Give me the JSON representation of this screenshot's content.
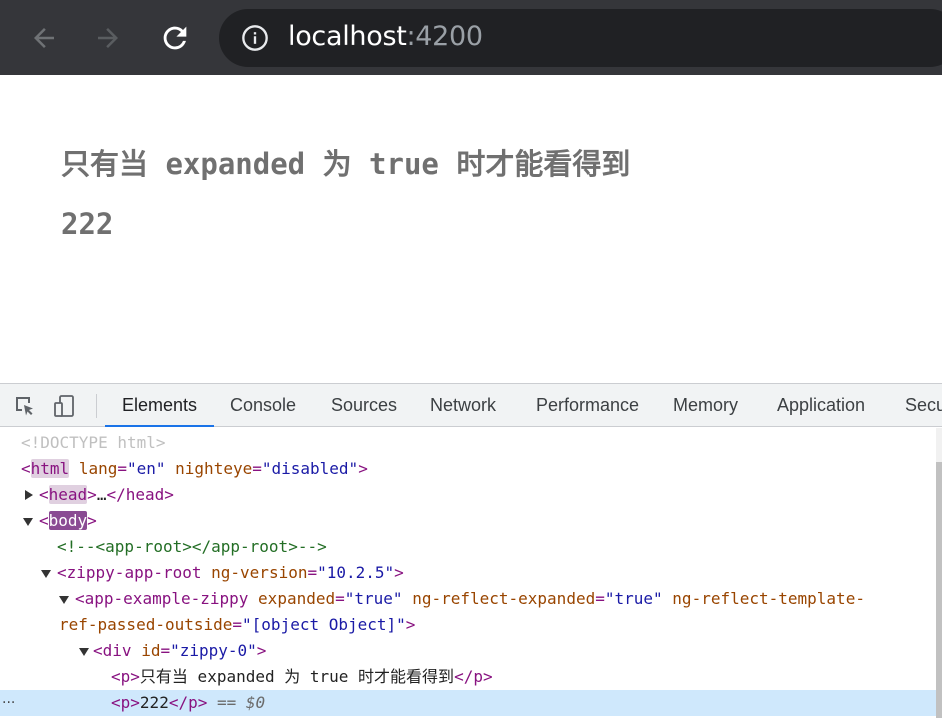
{
  "browser": {
    "url_host": "localhost",
    "url_port": ":4200",
    "icons": [
      "back-arrow-icon",
      "forward-arrow-icon",
      "reload-icon",
      "info-icon"
    ]
  },
  "page": {
    "lines": [
      "只有当 expanded 为 true 时才能看得到",
      "222"
    ]
  },
  "devtools": {
    "tabs": [
      "Elements",
      "Console",
      "Sources",
      "Network",
      "Performance",
      "Memory",
      "Application",
      "Secu"
    ],
    "active_tab": "Elements",
    "tools": [
      "inspect-element-icon",
      "device-toolbar-icon"
    ],
    "dom": {
      "doctype": "<!DOCTYPE html>",
      "html_tag": "html",
      "html_attr1_name": "lang",
      "html_attr1_value": "\"en\"",
      "html_attr2_name": "nighteye",
      "html_attr2_value": "\"disabled\"",
      "head_tag": "head",
      "head_ellipsis": "…",
      "body_tag": "body",
      "comment": "<!--<app-root></app-root>-->",
      "root_tag": "zippy-app-root",
      "root_attr_name": "ng-version",
      "root_attr_value": "\"10.2.5\"",
      "example_tag": "app-example-zippy",
      "ex_attr1_name": "expanded",
      "ex_attr1_value": "\"true\"",
      "ex_attr2_name": "ng-reflect-expanded",
      "ex_attr2_value": "\"true\"",
      "ex_attr3_name_a": "ng-reflect-template-",
      "ex_attr3_name_b": "ref-passed-outside",
      "ex_attr3_value": "\"[object Object]\"",
      "div_tag": "div",
      "div_attr_name": "id",
      "div_attr_value": "\"zippy-0\"",
      "p1_text": "只有当 expanded 为 true 时才能看得到",
      "p2_text": "222",
      "selected_marker": "== $0",
      "row_menu": "···"
    }
  },
  "colors": {
    "toolbar": "#35363a",
    "omnibox": "#202124",
    "tab_accent": "#1a73e8",
    "selected_row": "#cfe8fc",
    "body_tag_highlight": "#8a4b93"
  }
}
